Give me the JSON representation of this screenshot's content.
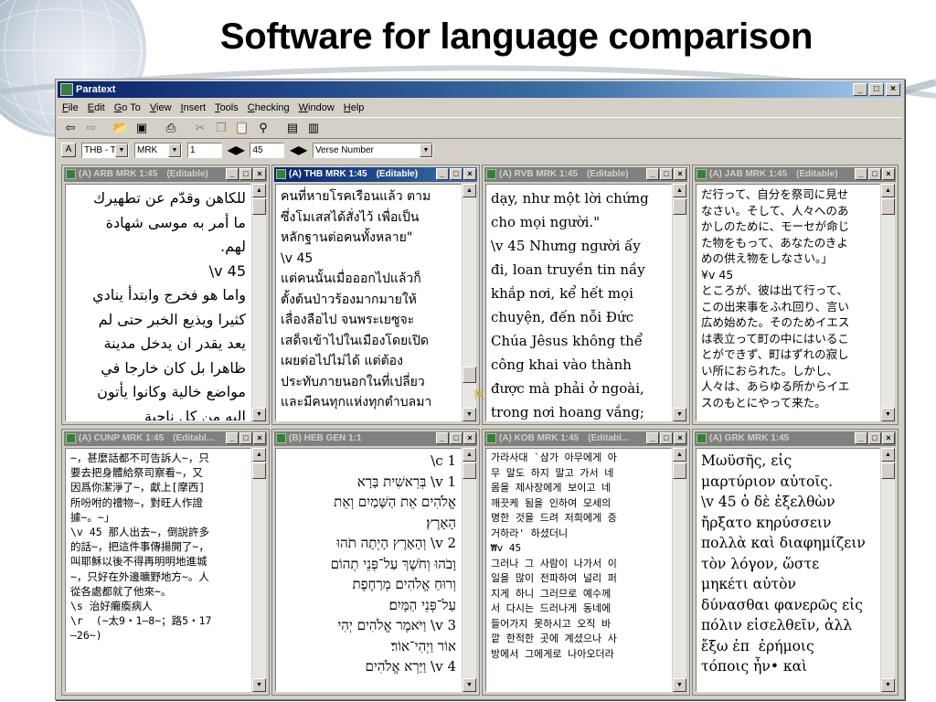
{
  "slide": {
    "title": "Software for language comparison"
  },
  "app": {
    "title": "Paratext",
    "window_buttons": [
      "_",
      "□",
      "×"
    ],
    "menu": [
      "File",
      "Edit",
      "Go To",
      "View",
      "Insert",
      "Tools",
      "Checking",
      "Window",
      "Help"
    ],
    "toolbar_icons": [
      "back-icon",
      "forward-icon",
      "open-folder-icon",
      "save-icon",
      "print-icon",
      "cut-icon",
      "copy-icon",
      "paste-icon",
      "find-icon",
      "window-icon",
      "window2-icon"
    ],
    "toolbar2": {
      "a_label": "A",
      "project": "THB - T",
      "book": "MRK",
      "chapter": "1",
      "verse": "45",
      "view_mode": "Verse Number"
    }
  },
  "panes": [
    {
      "title": "(A) ARB MRK 1:45",
      "editable_label": "(Editable)",
      "active": false,
      "text": "للكاهن وقدّم عن تطهيرك\nما أمر به موسى شهادة\nلهم.\nv 45\\\nواما هو فخرج وابتدأ ينادي\nكثيرا ويذيع الخبر حتى لم\nيعد يقدر ان يدخل مدينة\nظاهرا بل كان خارجا في\nمواضع خالية وكانوا يأتون\nاليه من كل ناحية"
    },
    {
      "title": "(A) THB MRK 1:45",
      "editable_label": "(Editable)",
      "active": true,
      "text": "คนที่หายโรคเรือนแล้ว ตาม\nซึ่งโมเสสได้สั่งไว้ เพื่อเป็น\nหลักฐานต่อคนทั้งหลาย\"\n\\v 45\nแต่คนนั้นเมื่อออกไปแล้วก็\nตั้งต้นป่าวร้องมากมายให้\nเลื่องลือไป จนพระเยซูจะ\nเสด็จเข้าไปในเมืองโดยเปิด\nเผยต่อไปไม่ได้ แต่ต้อง\nประทับภายนอกในที่เปลี่ยว\nและมีคนทุกแห่งทุกตำบลมา"
    },
    {
      "title": "(A) RVB MRK 1:45",
      "editable_label": "(Editable)",
      "active": false,
      "text": "dạy, như một lời chứng\ncho mọi người.\"\n\\v 45 Nhưng người ấy\nđi, loan truyền tin nầy\nkhắp nơi, kể hết mọi\nchuyện, đến nỗi Đức\nChúa Jêsus không thể\ncông khai vào thành\nđược mà phải ở ngoài,\ntrong nơi hoang vắng;"
    },
    {
      "title": "(A) JAB MRK 1:45",
      "editable_label": "(Editable)",
      "active": false,
      "text": "だ行って、自分を祭司に見せ\nなさい。そして、人々へのあ\nかしのために、モーセが命じ\nた物をもって、あなたのきよ\nめの供え物をしなさい。」\n¥v 45\nところが、彼は出て行って、\nこの出来事をふれ回り、言い\n広め始めた。そのためイエス\nは表立って町の中にはいるこ\nとができず、町はずれの寂し\nい所におられた。しかし、\n人々は、あらゆる所からイエ\nスのもとにやって来た。"
    },
    {
      "title": "(A) CUNP MRK 1:45",
      "editable_label": "(Editabl...",
      "active": false,
      "text": "~，甚麼話都不可告訴人~，只\n要去把身體給祭司察看~，又\n因爲你潔淨了~，獻上[摩西]\n所吩咐的禮物~，對旺人作證\n據~。~」\n\\v 45 那人出去~，倒說許多\n的話~，把這件事傳揚開了~，\n叫耶穌以後不得再明明地進城\n~，只好在外邊曠野地方~。人\n從各處都就了他來~。\n\\s 治好癱瘓病人\n\\r  (~太9・1—8~；路5・17\n—26~)"
    },
    {
      "title": "(B) HEB GEN 1:1",
      "editable_label": "",
      "active": false,
      "text": "c 1\\\nv 1\\ בְּרֵאשִׁית בָּרָא\nאֱלֹהִים אֵת הַשָּׁמַיִם וְאֵת\nהָאָרֶץ׃\nv 2\\ וְהָאָרֶץ הָיְתָה תֹהוּ\nוָבֹהוּ וְחֹשֶׁךְ עַל־פְּנֵי תְהוֹם\nוְרוּחַ אֱלֹהִים מְרַחֶפֶת\nעַל־פְּנֵי הַמָּיִם׃\nv 3\\ וַיֹּאמֶר אֱלֹהִים יְהִי\nאוֹר וַיְהִי־אוֹר׃\nv 4\\ וַיַּרְא אֱלֹהִים"
    },
    {
      "title": "(A) KOB MRK 1:45",
      "editable_label": "(Editabl...",
      "active": false,
      "text": "가라사대 `삼가 아무에게 아\n무 말도 하지 말고 가서 네\n몸을 제사장에게 보이고 네\n깨끗케 됨을 인하여 모세의\n명한 것을 드려 저희에게 증\n거하라' 하셨더니\n₩v 45\n그러나 그 사람이 나가서 이\n일을 많이 전파하여 널리 퍼\n지게 하니 그러므로 예수께\n서 다시는 드러나게 동네에\n들어가지 못하시고 오직 바\n깥 한적한 곳에 계셨으나 사\n방에서 그에게로 나아오더라"
    },
    {
      "title": "(A) GRK MRK 1:45",
      "editable_label": "",
      "active": false,
      "text": "Μωϋσῆς, εἰς\nμαρτύριον αὐτοῖς.\n\\v 45 ὁ δὲ ἐξελθὼν\nἤρξατο κηρύσσειν\nπολλὰ καὶ διαφημίζειν\nτὸν λόγον, ὥστε\nμηκέτι αὐτὸν\nδύνασθαι φανερῶς εἰς\nπόλιν εἰσελθεῖν, ἀλλ\nἔξω ἐπ  ἐρήμοις\nτόποις ἦν• καὶ"
    }
  ]
}
